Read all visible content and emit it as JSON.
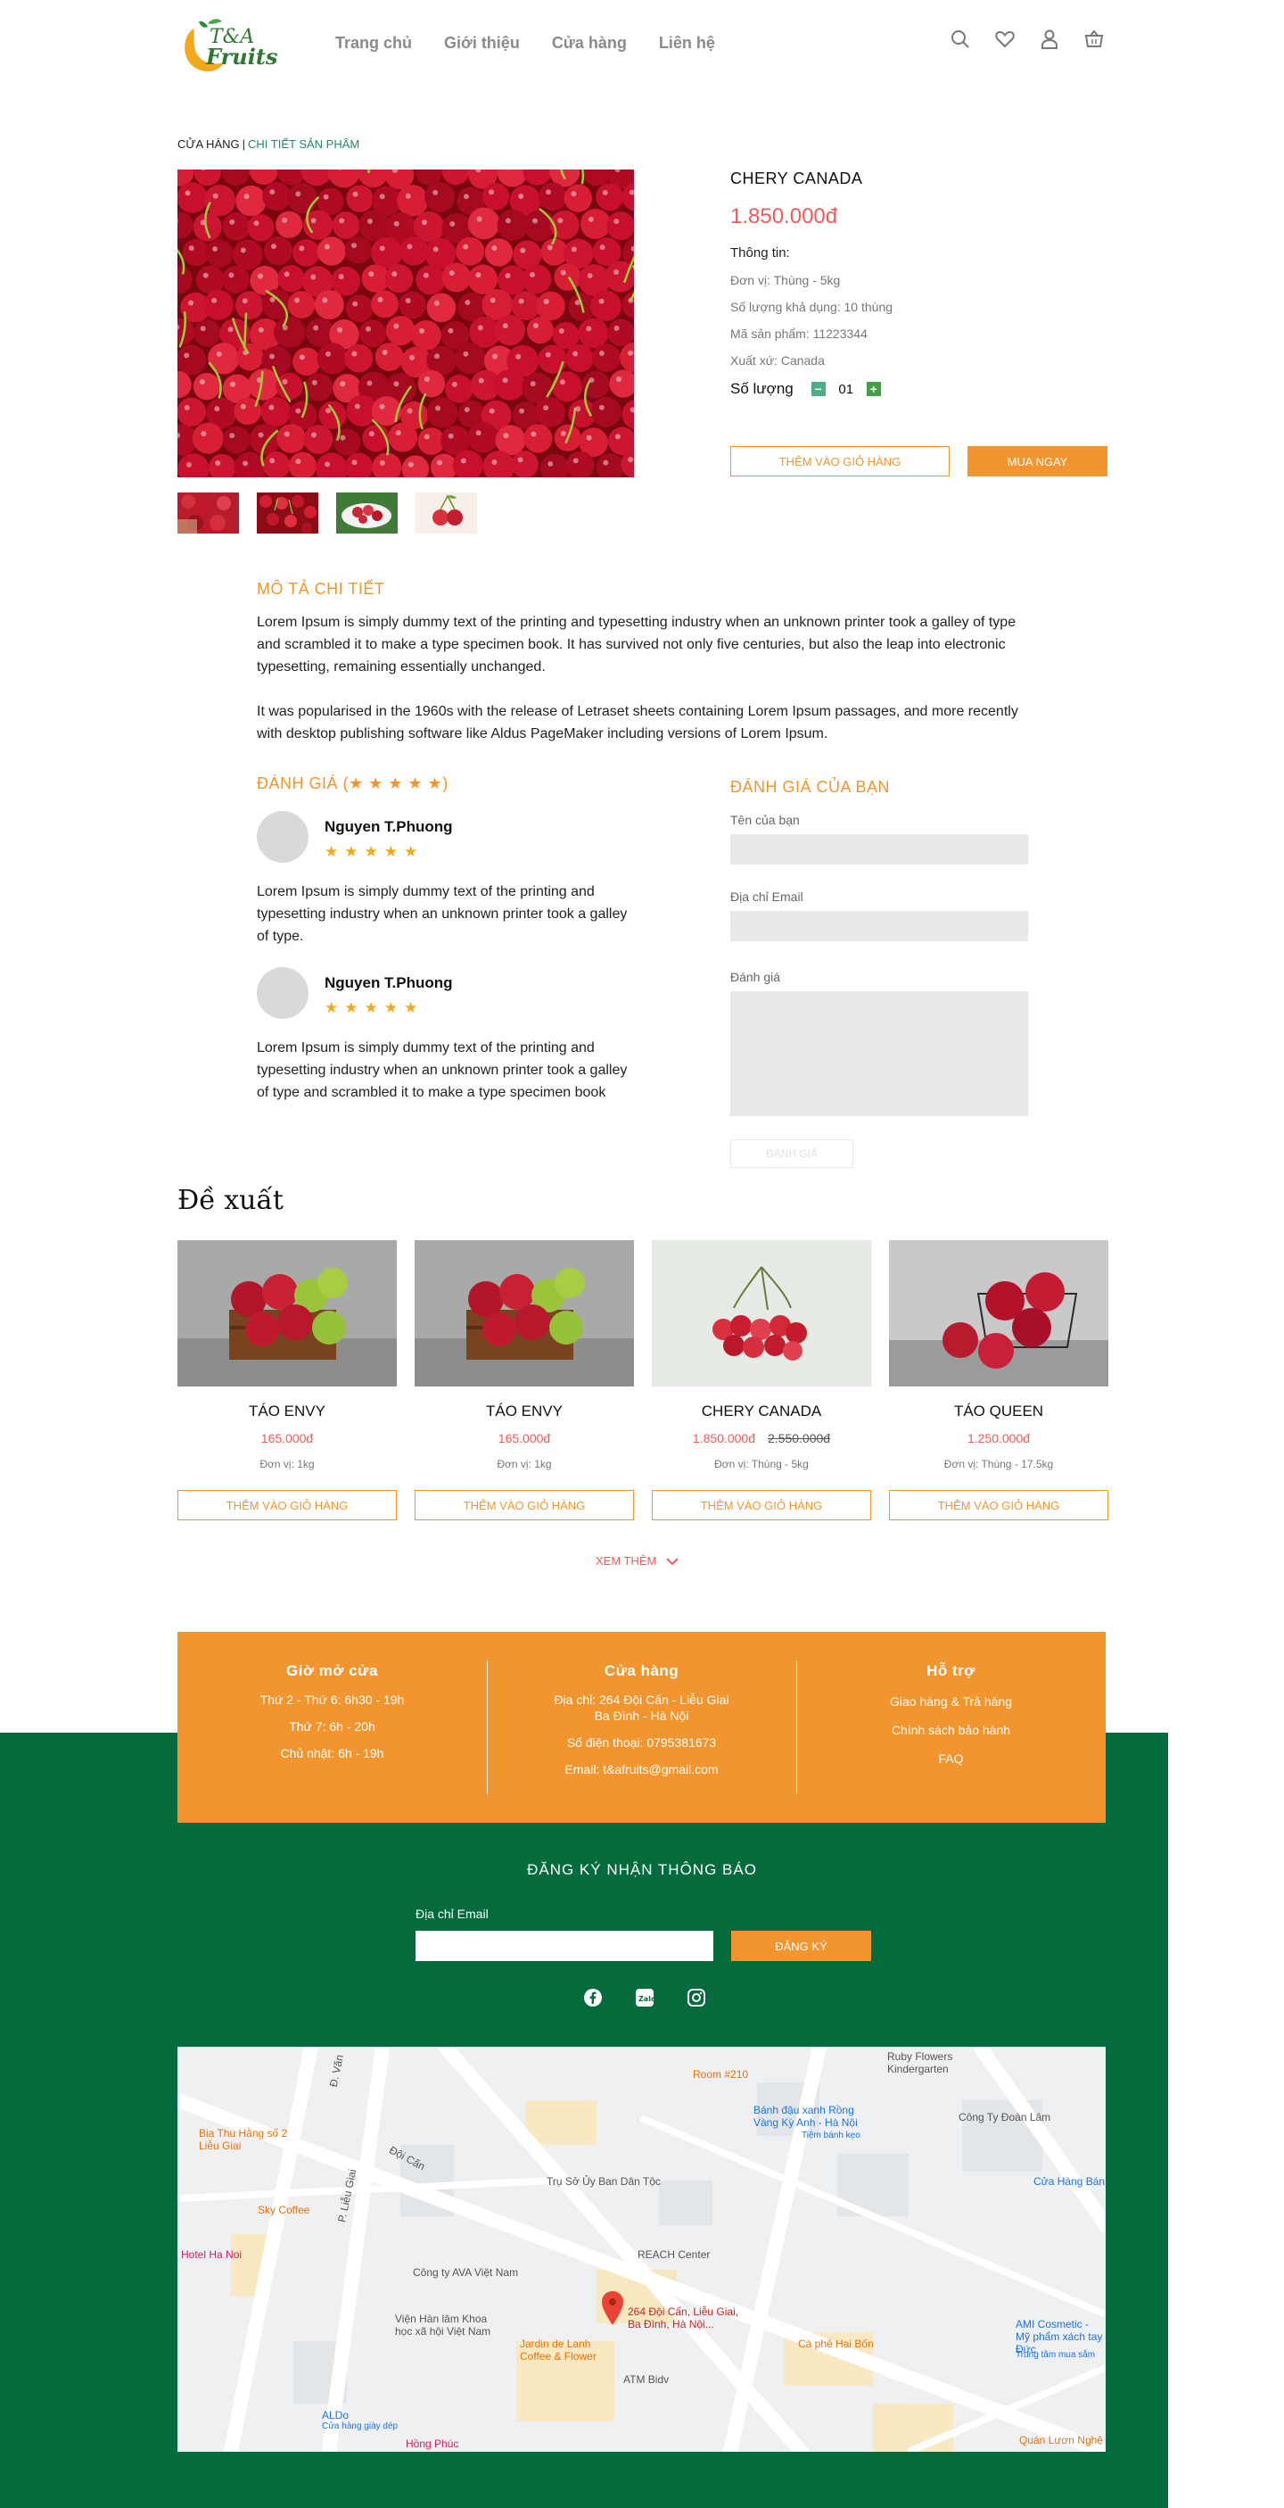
{
  "brand": {
    "logo_top": "T&A",
    "logo_bottom": "Fruits"
  },
  "nav": [
    "Trang chủ",
    "Giới thiệu",
    "Cửa hàng",
    "Liên hệ"
  ],
  "breadcrumb": {
    "root": "CỬA HÀNG",
    "sep": "|",
    "current": "CHI TIẾT SẢN PHẨM"
  },
  "product": {
    "name": "CHERY CANADA",
    "price": "1.850.000đ",
    "info_title": "Thông tin:",
    "unit": "Đơn vị: Thùng - 5kg",
    "stock": "Số lượng khả dụng: 10 thùng",
    "sku": "Mã sản phẩm: 11223344",
    "origin": "Xuất xứ: Canada",
    "qty_label": "Số lượng",
    "qty_value": "01",
    "add_to_cart": "THÊM VÀO GIỎ HÀNG",
    "buy_now": "MUA NGAY"
  },
  "description": {
    "title": "MÔ TẢ CHI TIẾT",
    "p1": "Lorem Ipsum is simply dummy text of the printing and typesetting industry when an unknown printer took a galley of type and scrambled it to make a type specimen book. It has survived not only five centuries, but also the leap into electronic typesetting, remaining essentially unchanged.",
    "p2": "It was popularised in the 1960s with the release of Letraset sheets containing Lorem Ipsum passages, and more recently with desktop publishing software like Aldus PageMaker including versions of Lorem Ipsum."
  },
  "reviews": {
    "title": "ĐÁNH GIÁ (★ ★ ★ ★ ★)",
    "items": [
      {
        "name": "Nguyen T.Phuong",
        "stars": "★★★★★",
        "text": "Lorem Ipsum is simply dummy text of the printing and typesetting industry when an unknown printer took a galley of type."
      },
      {
        "name": "Nguyen T.Phuong",
        "stars": "★★★★★",
        "text": "Lorem Ipsum is simply dummy text of the printing and typesetting industry when an unknown printer took a galley of type and scrambled it to make a type specimen book"
      }
    ]
  },
  "review_form": {
    "title": "ĐÁNH GIÁ CỦA BẠN",
    "name_label": "Tên của bạn",
    "email_label": "Địa chỉ Email",
    "review_label": "Đánh giá",
    "submit": "ĐÁNH GIÁ"
  },
  "suggested": {
    "title": "Đề xuất",
    "items": [
      {
        "name": "TÁO ENVY",
        "price": "165.000đ",
        "old_price": "",
        "unit": "Đơn vị: 1kg",
        "button": "THÊM VÀO GIỎ HÀNG"
      },
      {
        "name": "TÁO ENVY",
        "price": "165.000đ",
        "old_price": "",
        "unit": "Đơn vị: 1kg",
        "button": "THÊM VÀO GIỎ HÀNG"
      },
      {
        "name": "CHERY CANADA",
        "price": "1.850.000đ",
        "old_price": "2.550.000đ",
        "unit": "Đơn vị: Thùng - 5kg",
        "button": "THÊM VÀO GIỎ HÀNG"
      },
      {
        "name": "TÁO QUEEN",
        "price": "1.250.000đ",
        "old_price": "",
        "unit": "Đơn vị: Thùng - 17.5kg",
        "button": "THÊM VÀO GIỎ HÀNG"
      }
    ],
    "more": "XEM THÊM"
  },
  "footer": {
    "hours": {
      "title": "Giờ mở cửa",
      "l1": "Thứ 2 - Thứ 6: 6h30 - 19h",
      "l2": "Thứ 7: 6h - 20h",
      "l3": "Chủ nhật: 6h - 19h"
    },
    "store": {
      "title": "Cửa hàng",
      "l1": "Địa chỉ: 264 Đội Cấn - Liễu Giai",
      "l2": "Ba Đình - Hà Nội",
      "l3": "Số điện thoại: 0795381673",
      "l4": "Email: t&afruits@gmail.com"
    },
    "support": {
      "title": "Hỗ trợ",
      "l1": "Giao hàng & Trả hàng",
      "l2": "Chính sách bảo hành",
      "l3": "FAQ"
    },
    "subscribe_title": "ĐĂNG KÝ NHẬN THÔNG BÁO",
    "subscribe_label": "Địa chỉ Email",
    "subscribe_button": "ĐĂNG KÝ"
  },
  "map": {
    "labels": [
      "Room #210",
      "Ruby Flowers Kindergarten",
      "Bánh đậu xanh Rồng Vàng Kỳ Anh - Hà Nội",
      "Tiệm bánh kẹo",
      "Công Ty Đoàn Lâm",
      "Bia Thu Hằng số 2 Liễu Giai",
      "Trụ Sở Ủy Ban Dân Tộc",
      "Sky Coffee",
      "Cửa Hàng Bán",
      "Hotel Ha Noi",
      "REACH Center",
      "Công ty AVA Việt Nam",
      "Viện Hàn lâm Khoa học xã hội Việt Nam",
      "264 Đội Cấn, Liễu Giai, Ba Đình, Hà Nội...",
      "Jardin de Lanh Coffee & Flower",
      "Cà phê Hai Bốn",
      "AMI Cosmetic - Mỹ phẩm xách tay Đức",
      "Trung tâm mua sắm",
      "ATM Bidv",
      "ALDo",
      "Cửa hàng giày dép",
      "Hồng Phúc",
      "Quán Lươn Nghệ",
      "Đội Cấn",
      "P. Liễu Giai",
      "Đ. Văn"
    ]
  },
  "colors": {
    "accent": "#f2952e",
    "green": "#046b3c",
    "price": "#f05a5a",
    "breadcrumb": "#1f8a63"
  }
}
